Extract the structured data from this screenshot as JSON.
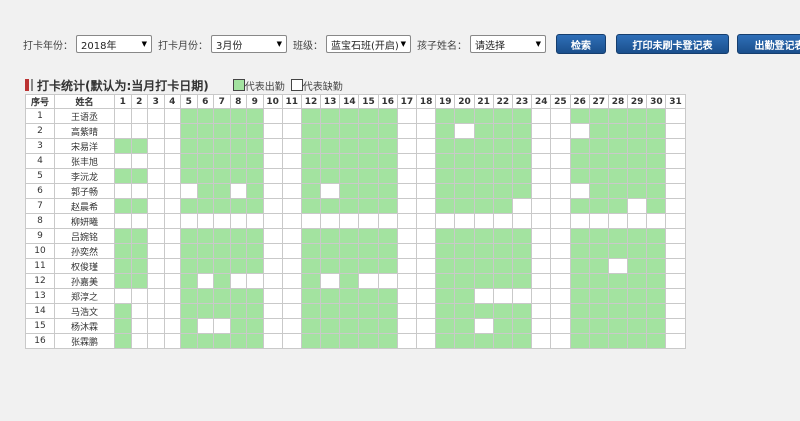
{
  "toolbar": {
    "year_label": "打卡年份：",
    "year_value": "2018年",
    "month_label": "打卡月份：",
    "month_value": "3月份",
    "class_label": "班级：",
    "class_value": "蓝宝石班(开启)",
    "child_label": "孩子姓名：",
    "child_value": "请选择",
    "search_label": "检索",
    "print_label": "打印未刷卡登记表",
    "attendance_label": "出勤登记表"
  },
  "section": {
    "title": "打卡统计(默认为:当月打卡日期)",
    "legend_present": "代表出勤",
    "legend_absent": "代表缺勤",
    "present_color": "#a3e3a0",
    "absent_color": "#ffffff"
  },
  "table": {
    "header_index": "序号",
    "header_name": "姓名",
    "days": [
      "1",
      "2",
      "3",
      "4",
      "5",
      "6",
      "7",
      "8",
      "9",
      "10",
      "11",
      "12",
      "13",
      "14",
      "15",
      "16",
      "17",
      "18",
      "19",
      "20",
      "21",
      "22",
      "23",
      "24",
      "25",
      "26",
      "27",
      "28",
      "29",
      "30",
      "31"
    ],
    "rows": [
      {
        "index": "1",
        "name": "王语丞",
        "att": "0000111110011111001111100111110"
      },
      {
        "index": "2",
        "name": "高紫晴",
        "att": "0000111110011111001011100011110"
      },
      {
        "index": "3",
        "name": "宋易洋",
        "att": "1100111110011111001111100111110"
      },
      {
        "index": "4",
        "name": "张丰旭",
        "att": "0000111110011111001111100111110"
      },
      {
        "index": "5",
        "name": "李沅龙",
        "att": "1100111110011111001111100111110"
      },
      {
        "index": "6",
        "name": "郭子畅",
        "att": "0000011010010111001111100011110"
      },
      {
        "index": "7",
        "name": "赵晨希",
        "att": "1100111110011111001111000111010"
      },
      {
        "index": "8",
        "name": "柳妍曦",
        "att": "0000000000000000000000000000000"
      },
      {
        "index": "9",
        "name": "吕婉铭",
        "att": "1100111110011111001111100111110"
      },
      {
        "index": "10",
        "name": "孙奕然",
        "att": "1100111110011111001111100111110"
      },
      {
        "index": "11",
        "name": "权俊瑾",
        "att": "1100111110011111001111100110110"
      },
      {
        "index": "12",
        "name": "孙嘉美",
        "att": "1100101000010100001111100111110"
      },
      {
        "index": "13",
        "name": "郑淳之",
        "att": "0000111110011111001100000111110"
      },
      {
        "index": "14",
        "name": "马浩文",
        "att": "1000111110011111001111100111110"
      },
      {
        "index": "15",
        "name": "杨沐霖",
        "att": "1000100110011111001101100111110"
      },
      {
        "index": "16",
        "name": "张霖鹏",
        "att": "1000111110011111001111100111110"
      }
    ]
  }
}
